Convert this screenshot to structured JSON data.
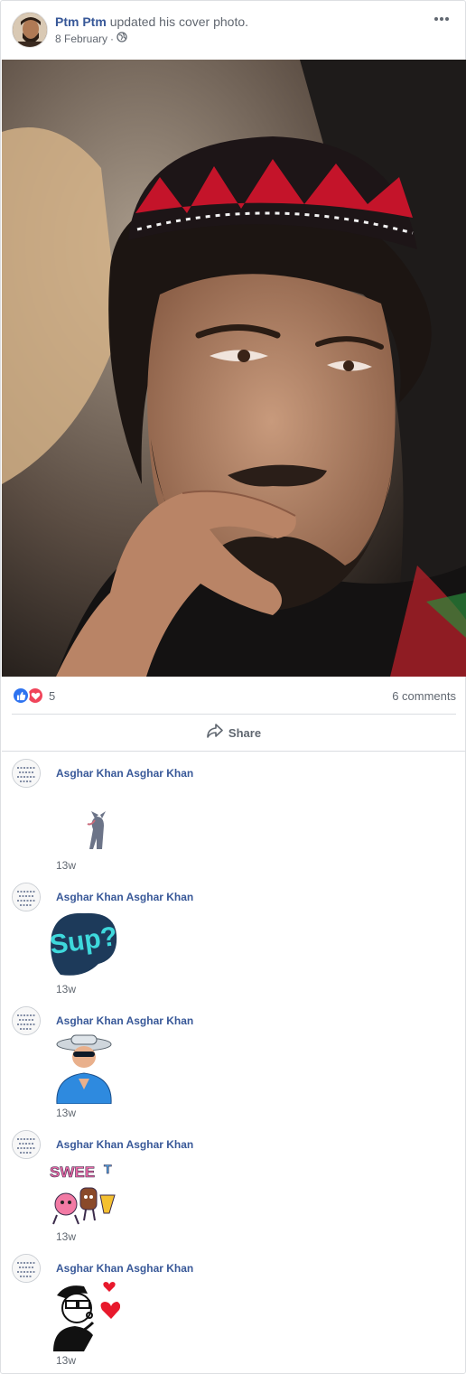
{
  "post": {
    "author": "Ptm Ptm",
    "action": "updated his cover photo.",
    "date": "8 February",
    "separator": "·",
    "privacy_icon": "globe-icon",
    "more_icon": "more-dots-icon"
  },
  "reactions": {
    "icons": [
      "like-icon",
      "love-icon"
    ],
    "count": "5",
    "comments_label": "6 comments"
  },
  "actions": {
    "share_label": "Share",
    "share_icon": "share-arrow-icon"
  },
  "comments": [
    {
      "author": "Asghar Khan Asghar Khan",
      "sticker": "cat-walking-sticker",
      "time": "13w"
    },
    {
      "author": "Asghar Khan Asghar Khan",
      "sticker": "sup-sticker",
      "time": "13w"
    },
    {
      "author": "Asghar Khan Asghar Khan",
      "sticker": "grandma-clapping-sticker",
      "time": "13w"
    },
    {
      "author": "Asghar Khan Asghar Khan",
      "sticker": "sweeet-sticker",
      "time": "13w"
    },
    {
      "author": "Asghar Khan Asghar Khan",
      "sticker": "kiss-hearts-sticker",
      "time": "13w"
    }
  ],
  "colors": {
    "link": "#385898",
    "secondary_text": "#606770",
    "like": "#2e73f0",
    "love": "#f0445a",
    "divider": "#dadde1"
  }
}
